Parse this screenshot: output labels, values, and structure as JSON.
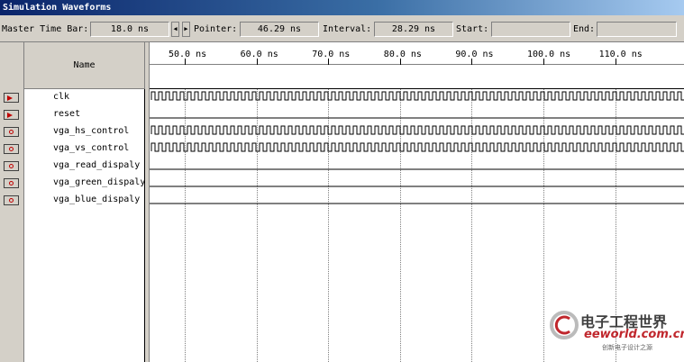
{
  "window": {
    "title": "Simulation Waveforms"
  },
  "toolbar": {
    "master_label": "Master Time Bar:",
    "master_value": "18.0 ns",
    "pointer_label": "Pointer:",
    "pointer_value": "46.29 ns",
    "interval_label": "Interval:",
    "interval_value": "28.29 ns",
    "start_label": "Start:",
    "start_value": "",
    "end_label": "End:",
    "end_value": "",
    "spin_left": "◀",
    "spin_right": "▶"
  },
  "columns": {
    "name_header": "Name"
  },
  "timeline": {
    "unit": "ns",
    "ticks": [
      "50.0 ns",
      "60.0 ns",
      "70.0 ns",
      "80.0 ns",
      "90.0 ns",
      "100.0 ns",
      "110.0 ns"
    ]
  },
  "signals": [
    {
      "name": "clk",
      "icon": "input-pin-icon",
      "wave": "clock"
    },
    {
      "name": "reset",
      "icon": "input-pin-icon",
      "wave": "low"
    },
    {
      "name": "vga_hs_control",
      "icon": "output-pin-icon",
      "wave": "clock"
    },
    {
      "name": "vga_vs_control",
      "icon": "output-pin-icon",
      "wave": "clock"
    },
    {
      "name": "vga_read_dispaly",
      "icon": "output-pin-icon",
      "wave": "low"
    },
    {
      "name": "vga_green_dispaly",
      "icon": "output-pin-icon",
      "wave": "low"
    },
    {
      "name": "vga_blue_dispaly",
      "icon": "output-pin-icon",
      "wave": "low"
    }
  ],
  "watermark": {
    "brand_cn": "电子工程世界",
    "site": "eeworld.com.cn",
    "slogan": "创新电子设计之源"
  },
  "colors": {
    "titlebar": "#0a246a",
    "chrome": "#d4d0c8",
    "icon_accent": "#c00000",
    "brand": "#c0272d"
  }
}
